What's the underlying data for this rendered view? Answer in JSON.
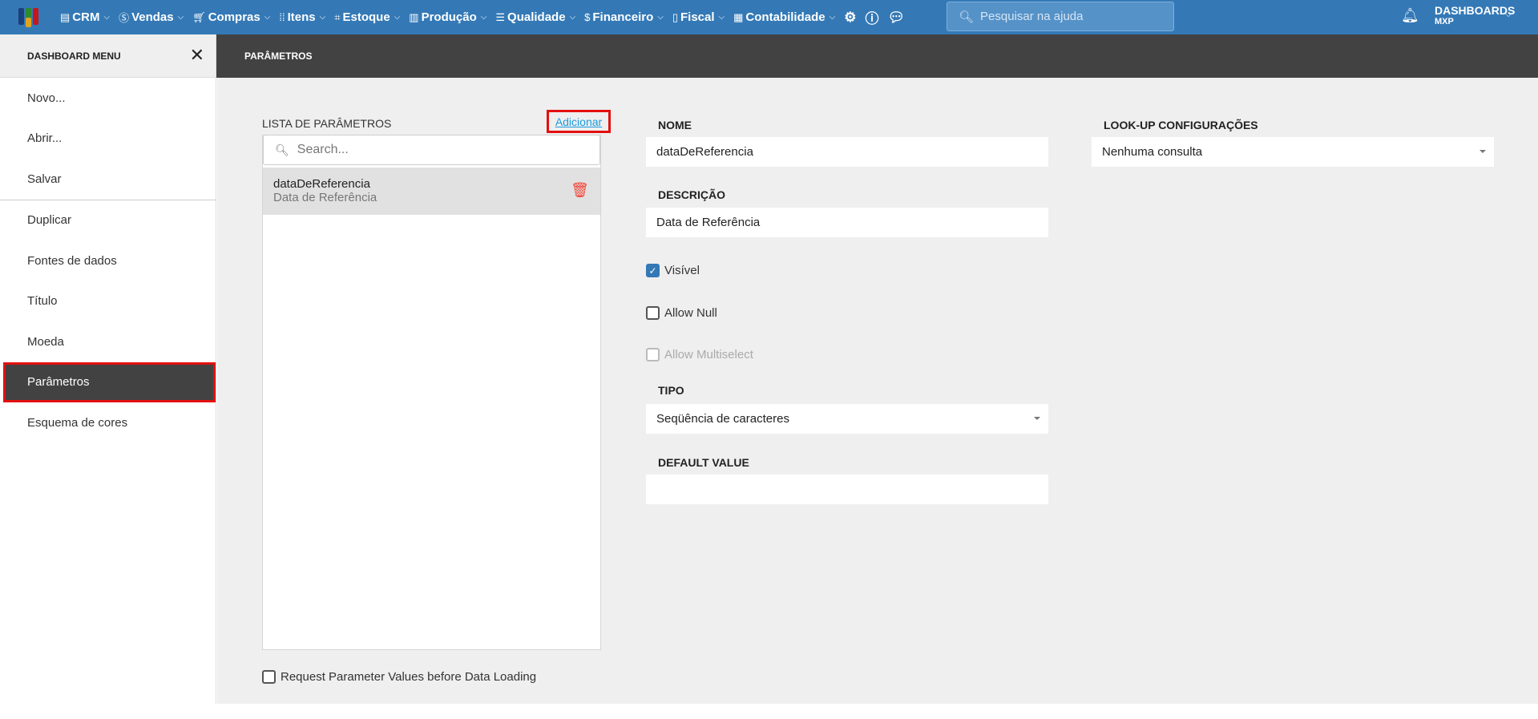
{
  "topbar": {
    "nav": [
      {
        "label": "CRM",
        "icon": "crm-icon"
      },
      {
        "label": "Vendas",
        "icon": "dollar-icon"
      },
      {
        "label": "Compras",
        "icon": "cart-icon"
      },
      {
        "label": "Itens",
        "icon": "items-icon"
      },
      {
        "label": "Estoque",
        "icon": "dolly-icon"
      },
      {
        "label": "Produção",
        "icon": "factory-icon"
      },
      {
        "label": "Qualidade",
        "icon": "checklist-icon"
      },
      {
        "label": "Financeiro",
        "icon": "money-bag-icon"
      },
      {
        "label": "Fiscal",
        "icon": "document-icon"
      },
      {
        "label": "Contabilidade",
        "icon": "calculator-icon"
      }
    ],
    "search_placeholder": "Pesquisar na ajuda",
    "user_title": "DASHBOARDS",
    "user_sub": "MXP",
    "colors": {
      "bar": "#3479b6"
    }
  },
  "sidebar": {
    "title": "DASHBOARD MENU",
    "items": [
      {
        "label": "Novo..."
      },
      {
        "label": "Abrir..."
      },
      {
        "label": "Salvar"
      },
      {
        "label": "Duplicar"
      },
      {
        "label": "Fontes de dados"
      },
      {
        "label": "Título"
      },
      {
        "label": "Moeda"
      },
      {
        "label": "Parâmetros"
      },
      {
        "label": "Esquema de cores"
      }
    ]
  },
  "header": {
    "title": "PARÂMETROS"
  },
  "list": {
    "title": "LISTA DE PARÂMETROS",
    "add_label": "Adicionar",
    "search_placeholder": "Search...",
    "items": [
      {
        "name": "dataDeReferencia",
        "description": "Data de Referência"
      }
    ]
  },
  "form": {
    "nome_label": "NOME",
    "nome_value": "dataDeReferencia",
    "descricao_label": "DESCRIÇÃO",
    "descricao_value": "Data de Referência",
    "visivel_label": "Visível",
    "visivel_checked": true,
    "allow_null_label": "Allow Null",
    "allow_null_checked": false,
    "allow_multiselect_label": "Allow Multiselect",
    "allow_multiselect_checked": false,
    "tipo_label": "TIPO",
    "tipo_value": "Seqüência de caracteres",
    "default_label": "DEFAULT VALUE",
    "default_value": "",
    "lookup_label": "LOOK-UP CONFIGURAÇÕES",
    "lookup_value": "Nenhuma consulta"
  },
  "request_label": "Request Parameter Values before Data Loading"
}
